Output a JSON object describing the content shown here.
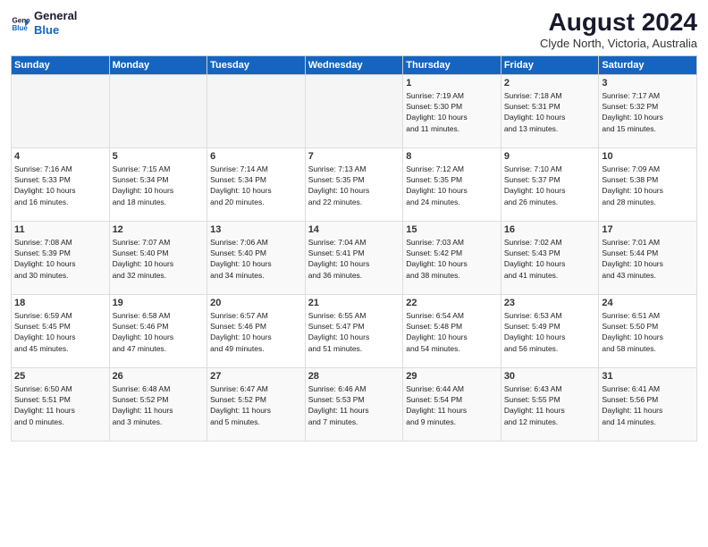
{
  "logo": {
    "line1": "General",
    "line2": "Blue"
  },
  "title": "August 2024",
  "location": "Clyde North, Victoria, Australia",
  "days_header": [
    "Sunday",
    "Monday",
    "Tuesday",
    "Wednesday",
    "Thursday",
    "Friday",
    "Saturday"
  ],
  "weeks": [
    [
      {
        "day": "",
        "info": ""
      },
      {
        "day": "",
        "info": ""
      },
      {
        "day": "",
        "info": ""
      },
      {
        "day": "",
        "info": ""
      },
      {
        "day": "1",
        "info": "Sunrise: 7:19 AM\nSunset: 5:30 PM\nDaylight: 10 hours\nand 11 minutes."
      },
      {
        "day": "2",
        "info": "Sunrise: 7:18 AM\nSunset: 5:31 PM\nDaylight: 10 hours\nand 13 minutes."
      },
      {
        "day": "3",
        "info": "Sunrise: 7:17 AM\nSunset: 5:32 PM\nDaylight: 10 hours\nand 15 minutes."
      }
    ],
    [
      {
        "day": "4",
        "info": "Sunrise: 7:16 AM\nSunset: 5:33 PM\nDaylight: 10 hours\nand 16 minutes."
      },
      {
        "day": "5",
        "info": "Sunrise: 7:15 AM\nSunset: 5:34 PM\nDaylight: 10 hours\nand 18 minutes."
      },
      {
        "day": "6",
        "info": "Sunrise: 7:14 AM\nSunset: 5:34 PM\nDaylight: 10 hours\nand 20 minutes."
      },
      {
        "day": "7",
        "info": "Sunrise: 7:13 AM\nSunset: 5:35 PM\nDaylight: 10 hours\nand 22 minutes."
      },
      {
        "day": "8",
        "info": "Sunrise: 7:12 AM\nSunset: 5:35 PM\nDaylight: 10 hours\nand 24 minutes."
      },
      {
        "day": "9",
        "info": "Sunrise: 7:10 AM\nSunset: 5:37 PM\nDaylight: 10 hours\nand 26 minutes."
      },
      {
        "day": "10",
        "info": "Sunrise: 7:09 AM\nSunset: 5:38 PM\nDaylight: 10 hours\nand 28 minutes."
      }
    ],
    [
      {
        "day": "11",
        "info": "Sunrise: 7:08 AM\nSunset: 5:39 PM\nDaylight: 10 hours\nand 30 minutes."
      },
      {
        "day": "12",
        "info": "Sunrise: 7:07 AM\nSunset: 5:40 PM\nDaylight: 10 hours\nand 32 minutes."
      },
      {
        "day": "13",
        "info": "Sunrise: 7:06 AM\nSunset: 5:40 PM\nDaylight: 10 hours\nand 34 minutes."
      },
      {
        "day": "14",
        "info": "Sunrise: 7:04 AM\nSunset: 5:41 PM\nDaylight: 10 hours\nand 36 minutes."
      },
      {
        "day": "15",
        "info": "Sunrise: 7:03 AM\nSunset: 5:42 PM\nDaylight: 10 hours\nand 38 minutes."
      },
      {
        "day": "16",
        "info": "Sunrise: 7:02 AM\nSunset: 5:43 PM\nDaylight: 10 hours\nand 41 minutes."
      },
      {
        "day": "17",
        "info": "Sunrise: 7:01 AM\nSunset: 5:44 PM\nDaylight: 10 hours\nand 43 minutes."
      }
    ],
    [
      {
        "day": "18",
        "info": "Sunrise: 6:59 AM\nSunset: 5:45 PM\nDaylight: 10 hours\nand 45 minutes."
      },
      {
        "day": "19",
        "info": "Sunrise: 6:58 AM\nSunset: 5:46 PM\nDaylight: 10 hours\nand 47 minutes."
      },
      {
        "day": "20",
        "info": "Sunrise: 6:57 AM\nSunset: 5:46 PM\nDaylight: 10 hours\nand 49 minutes."
      },
      {
        "day": "21",
        "info": "Sunrise: 6:55 AM\nSunset: 5:47 PM\nDaylight: 10 hours\nand 51 minutes."
      },
      {
        "day": "22",
        "info": "Sunrise: 6:54 AM\nSunset: 5:48 PM\nDaylight: 10 hours\nand 54 minutes."
      },
      {
        "day": "23",
        "info": "Sunrise: 6:53 AM\nSunset: 5:49 PM\nDaylight: 10 hours\nand 56 minutes."
      },
      {
        "day": "24",
        "info": "Sunrise: 6:51 AM\nSunset: 5:50 PM\nDaylight: 10 hours\nand 58 minutes."
      }
    ],
    [
      {
        "day": "25",
        "info": "Sunrise: 6:50 AM\nSunset: 5:51 PM\nDaylight: 11 hours\nand 0 minutes."
      },
      {
        "day": "26",
        "info": "Sunrise: 6:48 AM\nSunset: 5:52 PM\nDaylight: 11 hours\nand 3 minutes."
      },
      {
        "day": "27",
        "info": "Sunrise: 6:47 AM\nSunset: 5:52 PM\nDaylight: 11 hours\nand 5 minutes."
      },
      {
        "day": "28",
        "info": "Sunrise: 6:46 AM\nSunset: 5:53 PM\nDaylight: 11 hours\nand 7 minutes."
      },
      {
        "day": "29",
        "info": "Sunrise: 6:44 AM\nSunset: 5:54 PM\nDaylight: 11 hours\nand 9 minutes."
      },
      {
        "day": "30",
        "info": "Sunrise: 6:43 AM\nSunset: 5:55 PM\nDaylight: 11 hours\nand 12 minutes."
      },
      {
        "day": "31",
        "info": "Sunrise: 6:41 AM\nSunset: 5:56 PM\nDaylight: 11 hours\nand 14 minutes."
      }
    ]
  ]
}
